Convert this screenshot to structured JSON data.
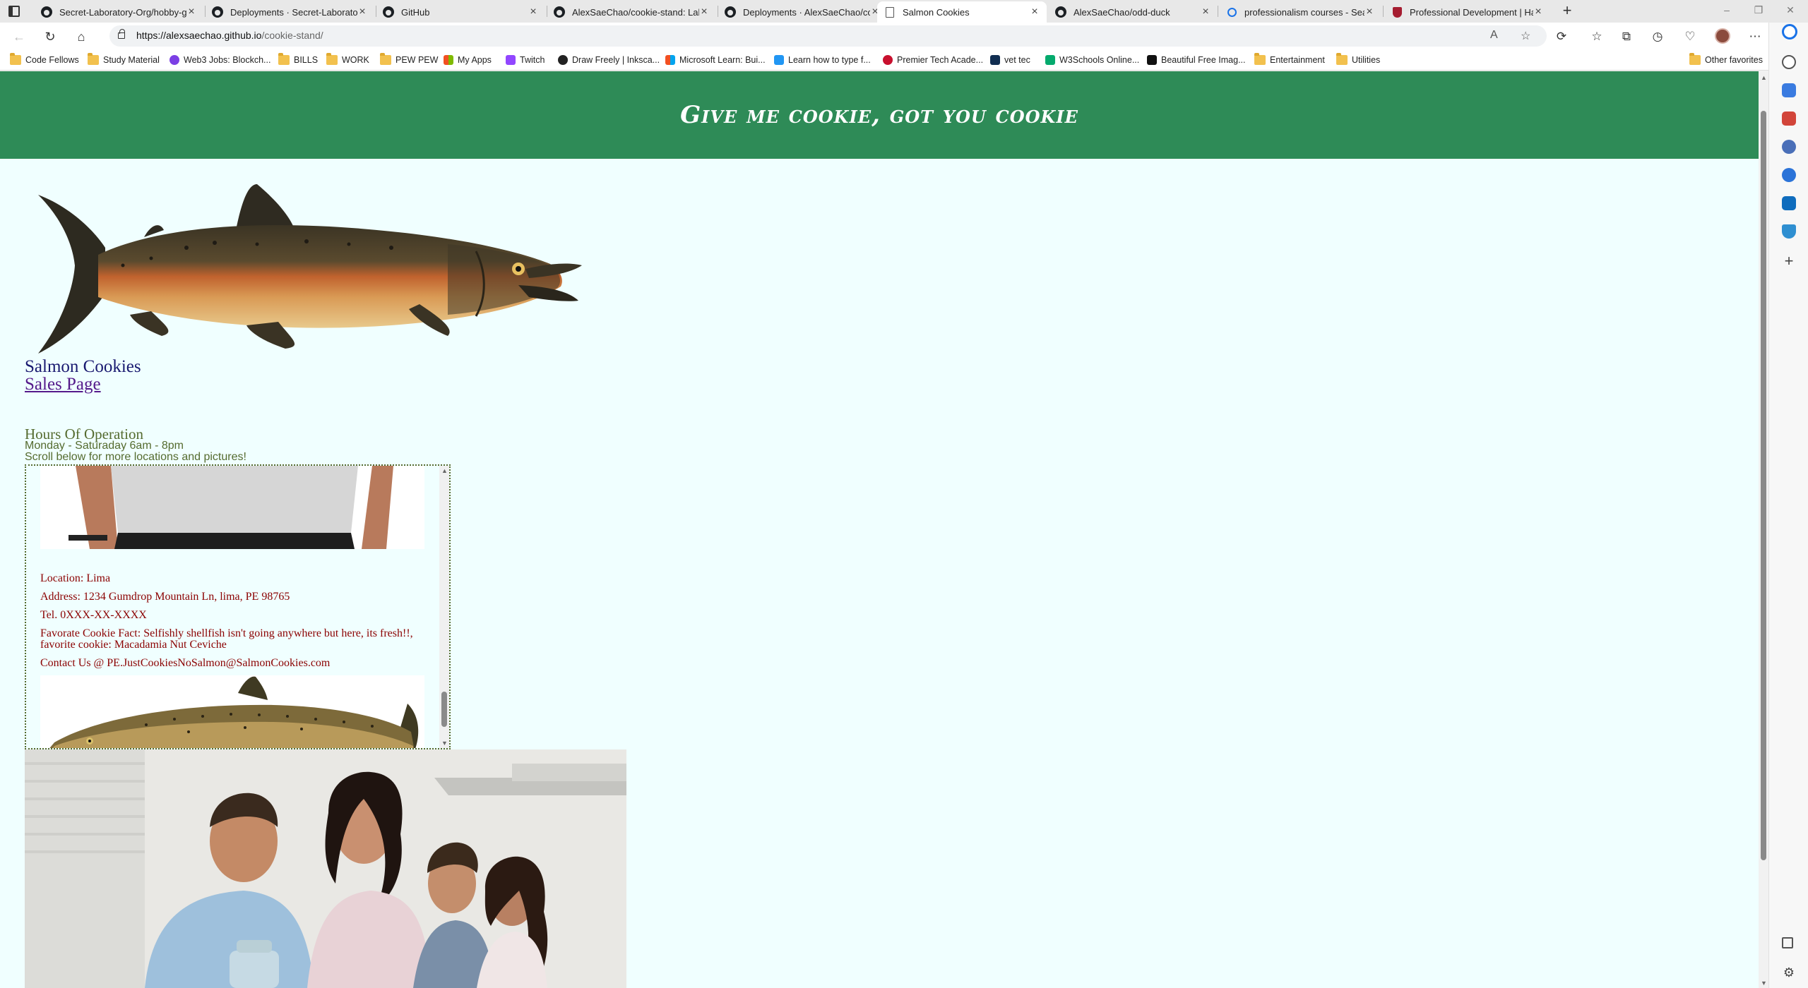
{
  "browser": {
    "tabs": [
      {
        "title": "Secret-Laboratory-Org/hobby-g",
        "icon": "github-icon"
      },
      {
        "title": "Deployments · Secret-Laboratory",
        "icon": "github-icon"
      },
      {
        "title": "GitHub",
        "icon": "github-icon"
      },
      {
        "title": "AlexSaeChao/cookie-stand: Lab",
        "icon": "github-icon"
      },
      {
        "title": "Deployments · AlexSaeChao/coo",
        "icon": "github-icon"
      },
      {
        "title": "Salmon Cookies",
        "icon": "page-icon"
      },
      {
        "title": "AlexSaeChao/odd-duck",
        "icon": "github-icon"
      },
      {
        "title": "professionalism courses - Search",
        "icon": "search-icon"
      },
      {
        "title": "Professional Development | Harv",
        "icon": "harvard-shield-icon"
      }
    ],
    "active_tab_index": 5,
    "url_host": "https://alexsaechao.github.io",
    "url_path": "/cookie-stand/",
    "bookmarks": [
      {
        "label": "Code Fellows",
        "icon": "folder-icon"
      },
      {
        "label": "Study Material",
        "icon": "folder-icon"
      },
      {
        "label": "Web3 Jobs: Blockch...",
        "icon": "web3-icon"
      },
      {
        "label": "BILLS",
        "icon": "folder-icon"
      },
      {
        "label": "WORK",
        "icon": "folder-icon"
      },
      {
        "label": "PEW PEW",
        "icon": "folder-icon"
      },
      {
        "label": "My Apps",
        "icon": "apps-icon"
      },
      {
        "label": "Twitch",
        "icon": "twitch-icon"
      },
      {
        "label": "Draw Freely | Inksca...",
        "icon": "inkscape-icon"
      },
      {
        "label": "Microsoft Learn: Bui...",
        "icon": "microsoft-icon"
      },
      {
        "label": "Learn how to type f...",
        "icon": "typing-icon"
      },
      {
        "label": "Premier Tech Acade...",
        "icon": "premier-tech-icon"
      },
      {
        "label": "vet tec",
        "icon": "va-icon"
      },
      {
        "label": "W3Schools Online...",
        "icon": "w3schools-icon"
      },
      {
        "label": "Beautiful Free Imag...",
        "icon": "unsplash-icon"
      },
      {
        "label": "Entertainment",
        "icon": "folder-icon"
      },
      {
        "label": "Utilities",
        "icon": "folder-icon"
      }
    ],
    "other_favorites": "Other favorites"
  },
  "page": {
    "header_title": "Give me cookie, got you cookie",
    "brand": "Salmon Cookies",
    "sales_link": "Sales Page",
    "hours_title": "Hours Of Operation",
    "hours_text": "Monday - Saturaday 6am - 8pm",
    "scroll_hint": "Scroll below for more locations and pictures!",
    "location": {
      "location": "Location: Lima",
      "address": "Address: 1234 Gumdrop Mountain Ln, lima, PE 98765",
      "tel": "Tel. 0XXX-XX-XXXX",
      "fact": "Favorate Cookie Fact: Selfishly shellfish isn't going anywhere but here, its fresh!!, favorite cookie: Macadamia Nut Ceviche",
      "contact": "Contact Us @ PE.JustCookiesNoSalmon@SalmonCookies.com"
    }
  },
  "colors": {
    "header_green": "#2e8b57",
    "page_bg": "#f0ffff",
    "brand_navy": "#191970",
    "olive_text": "#556b2f",
    "location_text": "#8b0000"
  }
}
